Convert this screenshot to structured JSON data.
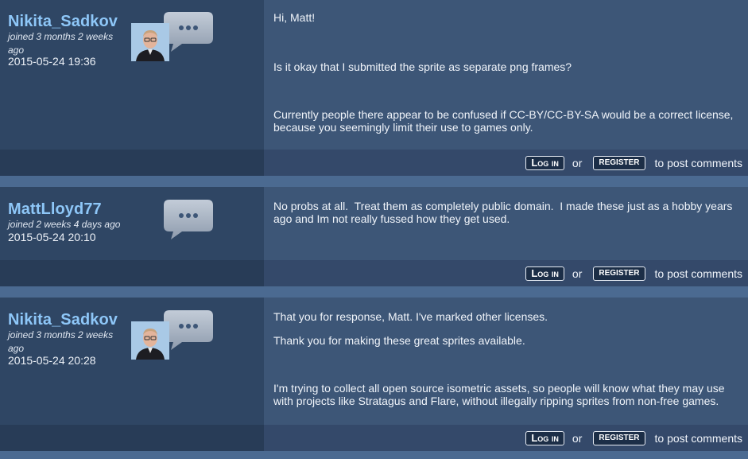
{
  "post_links": {
    "login_label": "Log in",
    "or_label": "or",
    "register_label": "register",
    "tail_label": "to post comments"
  },
  "comments": [
    {
      "username": "Nikita_Sadkov",
      "joined": "joined 3 months 2 weeks ago",
      "date": "2015-05-24 19:36",
      "has_avatar": true,
      "paragraphs": [
        "Hi, Matt!",
        "Is it okay that I submitted the sprite as separate png frames?",
        "Currently people there appear to be confused if CC-BY/CC-BY-SA would be a correct license, because you seemingly limit their use to games only."
      ]
    },
    {
      "username": "MattLloyd77",
      "joined": "joined 2 weeks 4 days ago",
      "date": "2015-05-24 20:10",
      "has_avatar": false,
      "paragraphs": [
        "No probs at all.  Treat them as completely public domain.  I made these just as a hobby years ago and Im not really fussed how they get used."
      ]
    },
    {
      "username": "Nikita_Sadkov",
      "joined": "joined 3 months 2 weeks ago",
      "date": "2015-05-24 20:28",
      "has_avatar": true,
      "paragraphs": [
        "That you for response, Matt. I've marked other licenses.",
        "Thank you for making these great sprites available.",
        "I'm trying to collect all open source isometric assets, so people will know what they may use with projects like Stratagus and Flare, without illegally ripping sprites from non-free games."
      ]
    }
  ],
  "icons": {
    "comment_bubble": "speech-bubble-icon",
    "avatar": "user-avatar"
  },
  "colors": {
    "username": "#8ec7f8",
    "sidebar_bg": "#2f4664",
    "content_bg": "#3d5677",
    "separator": "#4b6a91"
  }
}
